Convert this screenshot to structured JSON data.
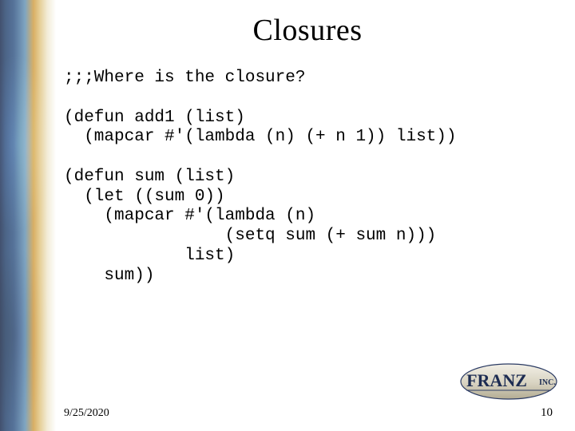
{
  "title": "Closures",
  "code_lines": [
    ";;;Where is the closure?",
    "",
    "(defun add1 (list)",
    "  (mapcar #'(lambda (n) (+ n 1)) list))",
    "",
    "(defun sum (list)",
    "  (let ((sum 0))",
    "    (mapcar #'(lambda (n)",
    "                (setq sum (+ sum n)))",
    "            list)",
    "    sum))"
  ],
  "footer": {
    "date": "9/25/2020",
    "page_number": "10"
  },
  "logo": {
    "text_main": "FRANZ",
    "text_suffix": "INC."
  }
}
